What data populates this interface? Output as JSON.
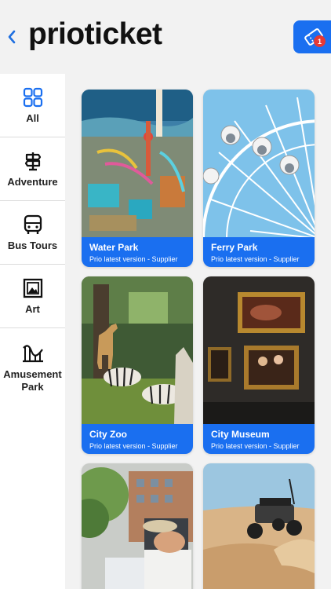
{
  "header": {
    "back_icon": "chevron-left-icon",
    "logo_text": "prioticket",
    "cart_icon": "ticket-icon",
    "cart_count": "1",
    "accent": "#1a6ff0"
  },
  "sidebar": {
    "items": [
      {
        "label": "All",
        "icon": "grid-icon"
      },
      {
        "label": "Adventure",
        "icon": "signpost-icon"
      },
      {
        "label": "Bus Tours",
        "icon": "bus-icon"
      },
      {
        "label": "Art",
        "icon": "picture-frame-icon"
      },
      {
        "label": "Amusement Park",
        "icon": "roller-coaster-icon"
      }
    ]
  },
  "products": [
    {
      "title": "Water Park",
      "subtitle": "Prio latest version -  Supplier"
    },
    {
      "title": "Ferry Park",
      "subtitle": "Prio latest version -  Supplier"
    },
    {
      "title": "City Zoo",
      "subtitle": "Prio latest version -  Supplier"
    },
    {
      "title": "City Museum",
      "subtitle": "Prio latest version -  Supplier"
    },
    {
      "title": "",
      "subtitle": ""
    },
    {
      "title": "",
      "subtitle": ""
    }
  ]
}
